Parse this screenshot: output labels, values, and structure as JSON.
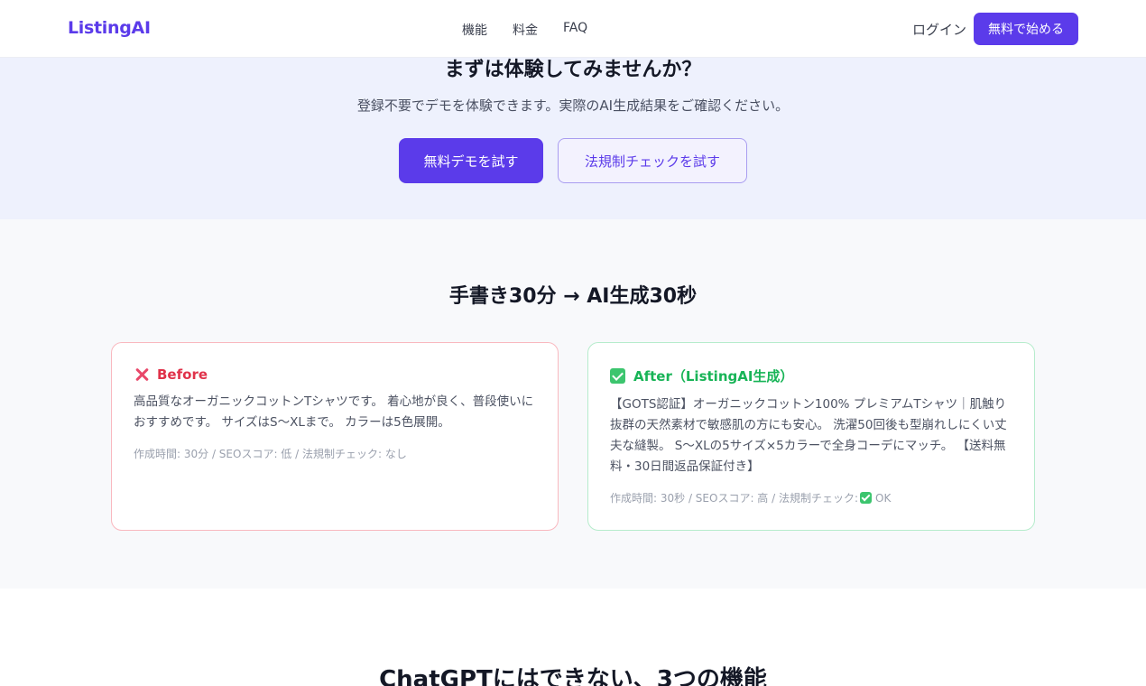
{
  "header": {
    "logo": "ListingAI",
    "nav": [
      "機能",
      "料金",
      "FAQ"
    ],
    "login": "ログイン",
    "start": "無料で始める"
  },
  "demo": {
    "title": "まずは体験してみませんか？",
    "subtitle": "登録不要でデモを体験できます。実際のAI生成結果をご確認ください。",
    "primary_button": "無料デモを試す",
    "secondary_button": "法規制チェックを試す"
  },
  "compare": {
    "title": "手書き30分 → AI生成30秒",
    "before": {
      "heading": "Before",
      "body": "高品質なオーガニックコットンTシャツです。 着心地が良く、普段使いにおすすめです。 サイズはS〜XLまで。 カラーは5色展開。",
      "meta": "作成時間: 30分 / SEOスコア: 低 / 法規制チェック: なし"
    },
    "after": {
      "heading": "After（ListingAI生成）",
      "body": "【GOTS認証】オーガニックコットン100% プレミアムTシャツ｜肌触り抜群の天然素材で敏感肌の方にも安心。 洗濯50回後も型崩れしにくい丈夫な縫製。 S〜XLの5サイズ×5カラーで全身コーデにマッチ。 【送料無料・30日間返品保証付き】",
      "meta_prefix": "作成時間: 30秒 / SEOスコア: 高 / 法規制チェック:",
      "meta_suffix": "OK"
    }
  },
  "features": {
    "title": "ChatGPTにはできない、3つの機能"
  },
  "colors": {
    "brand": "#5b3bea",
    "before_accent": "#e0324a",
    "after_accent": "#18b457"
  },
  "icons": {
    "before": "close-icon",
    "after": "check-icon"
  }
}
